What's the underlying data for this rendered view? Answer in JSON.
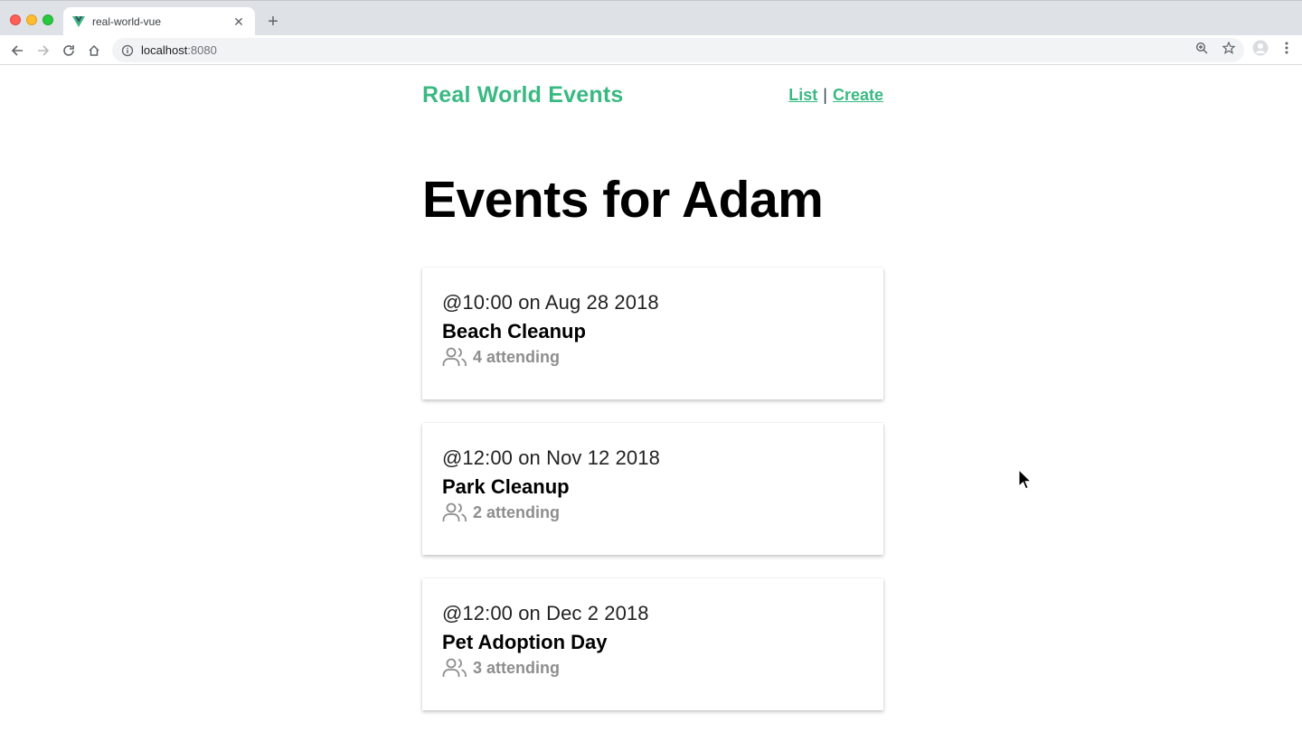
{
  "browser": {
    "tab_title": "real-world-vue",
    "url_host": "localhost",
    "url_port": ":8080",
    "icons": [
      "back-icon",
      "forward-icon",
      "reload-icon",
      "home-icon",
      "info-icon",
      "zoom-icon",
      "star-icon",
      "profile-icon",
      "menu-icon"
    ]
  },
  "site": {
    "brand": "Real World Events",
    "nav": {
      "list": "List",
      "separator": "|",
      "create": "Create"
    },
    "accent": "#39b982"
  },
  "page": {
    "title": "Events for Adam"
  },
  "events": [
    {
      "time": "@10:00 on Aug 28 2018",
      "title": "Beach Cleanup",
      "attending": "4 attending"
    },
    {
      "time": "@12:00 on Nov 12 2018",
      "title": "Park Cleanup",
      "attending": "2 attending"
    },
    {
      "time": "@12:00 on Dec 2 2018",
      "title": "Pet Adoption Day",
      "attending": "3 attending"
    }
  ]
}
